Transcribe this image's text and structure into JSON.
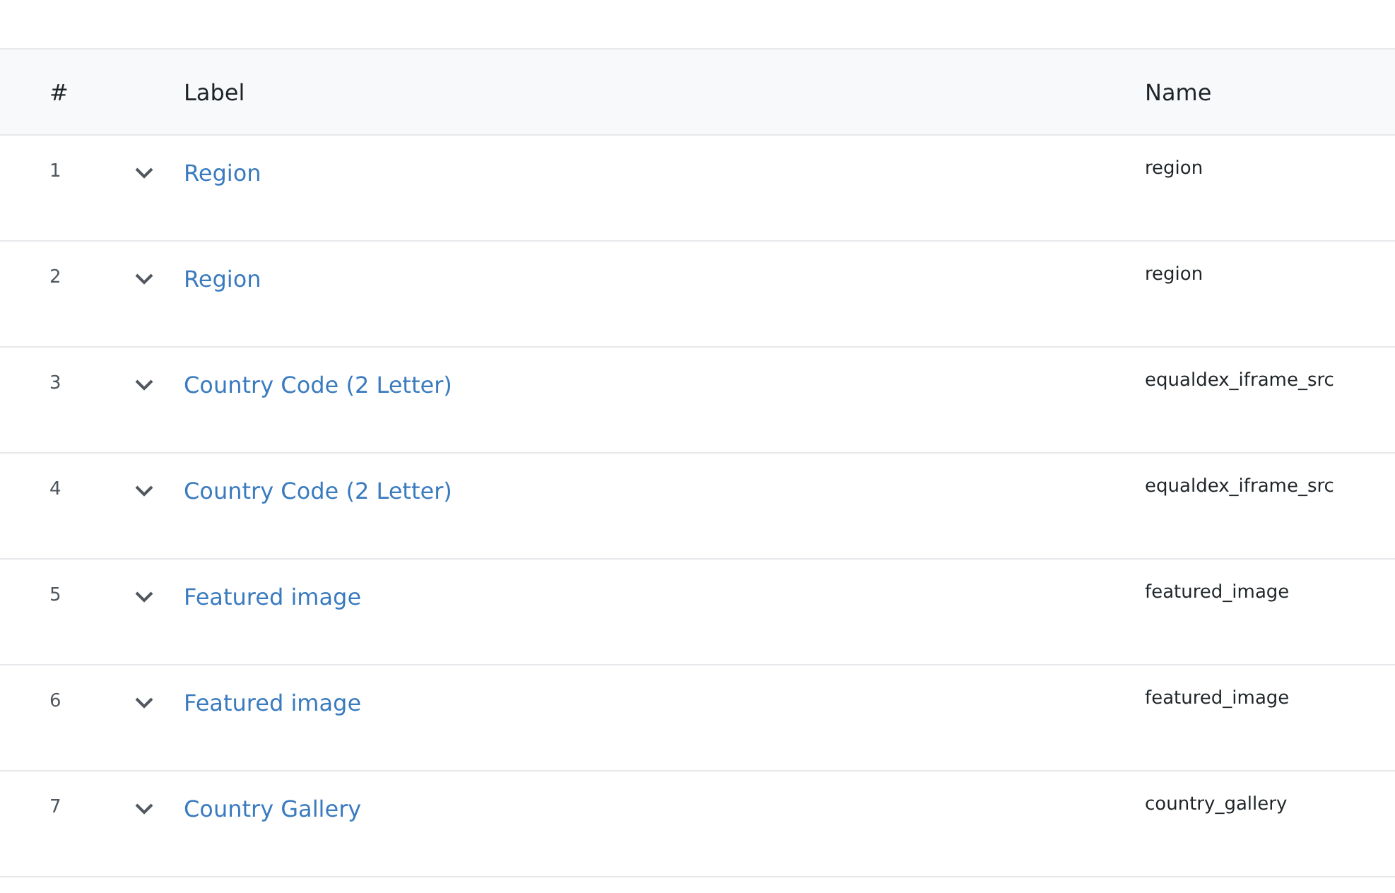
{
  "table": {
    "columns": [
      "#",
      "Label",
      "Name"
    ],
    "rows": [
      {
        "number": "1",
        "label": "Region",
        "name": "region"
      },
      {
        "number": "2",
        "label": "Region",
        "name": "region"
      },
      {
        "number": "3",
        "label": "Country Code (2 Letter)",
        "name": "equaldex_iframe_src"
      },
      {
        "number": "4",
        "label": "Country Code (2 Letter)",
        "name": "equaldex_iframe_src"
      },
      {
        "number": "5",
        "label": "Featured image",
        "name": "featured_image"
      },
      {
        "number": "6",
        "label": "Featured image",
        "name": "featured_image"
      },
      {
        "number": "7",
        "label": "Country Gallery",
        "name": "country_gallery"
      }
    ]
  }
}
